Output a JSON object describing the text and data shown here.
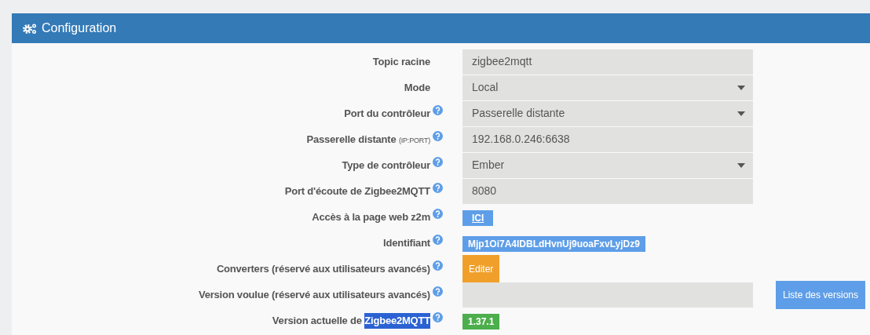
{
  "panel": {
    "title": "Configuration"
  },
  "rows": [
    {
      "kind": "text",
      "label": "Topic racine",
      "help": false,
      "value": "zigbee2mqtt"
    },
    {
      "kind": "select",
      "label": "Mode",
      "help": false,
      "value": "Local"
    },
    {
      "kind": "select",
      "label": "Port du contrôleur",
      "help": true,
      "value": "Passerelle distante"
    },
    {
      "kind": "text",
      "label": "Passerelle distante",
      "label_small": "(IP:PORT)",
      "help": true,
      "value": "192.168.0.246:6638"
    },
    {
      "kind": "select",
      "label": "Type de contrôleur",
      "help": true,
      "value": "Ember"
    },
    {
      "kind": "text",
      "label": "Port d'écoute de Zigbee2MQTT",
      "help": true,
      "value": "8080"
    },
    {
      "kind": "link",
      "label": "Accès à la page web z2m",
      "help": true,
      "value": "ICI"
    },
    {
      "kind": "tag",
      "label": "Identifiant",
      "help": true,
      "value": "Mjp1Oi7A4IDBLdHvnUj9uoaFxvLyjDz9",
      "color": "#5e9ee8"
    },
    {
      "kind": "button",
      "label": "Converters (réservé aux utilisateurs avancés)",
      "help": true,
      "value": "Editer"
    },
    {
      "kind": "input_button",
      "label": "Version voulue (réservé aux utilisateurs avancés)",
      "help": true,
      "button": "Liste des versions"
    },
    {
      "kind": "tag",
      "label": "Version actuelle de",
      "label_selected": "Zigbee2MQTT",
      "help": true,
      "value": "1.37.1",
      "color": "#4cae4c"
    }
  ]
}
